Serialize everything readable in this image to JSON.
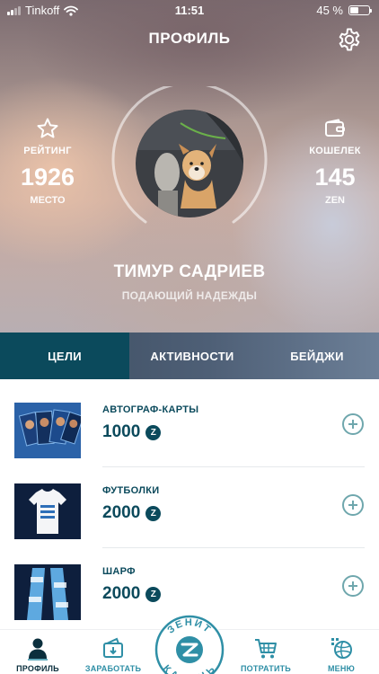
{
  "status_bar": {
    "carrier": "Tinkoff",
    "time": "11:51",
    "battery_percent": "45 %",
    "battery_level": 0.45
  },
  "header": {
    "title": "ПРОФИЛЬ",
    "settings_icon": "gear-icon"
  },
  "rating": {
    "label": "РЕЙТИНГ",
    "value": "1926",
    "sub": "МЕСТО",
    "icon": "star-icon"
  },
  "wallet": {
    "label": "КОШЕЛЕК",
    "value": "145",
    "sub": "ZEN",
    "icon": "wallet-icon"
  },
  "user": {
    "name": "ТИМУР САДРИЕВ",
    "status": "ПОДАЮЩИЙ НАДЕЖДЫ"
  },
  "tabs": [
    {
      "label": "ЦЕЛИ",
      "active": true
    },
    {
      "label": "АКТИВНОСТИ",
      "active": false
    },
    {
      "label": "БЕЙДЖИ",
      "active": false
    }
  ],
  "goals": [
    {
      "name": "АВТОГРАФ-КАРТЫ",
      "price": "1000",
      "coin_symbol": "Z"
    },
    {
      "name": "ФУТБОЛКИ",
      "price": "2000",
      "coin_symbol": "Z"
    },
    {
      "name": "ШАРФ",
      "price": "2000",
      "coin_symbol": "Z"
    }
  ],
  "tabbar": {
    "items": [
      {
        "label": "ПРОФИЛЬ",
        "icon": "profile-icon",
        "active": true
      },
      {
        "label": "ЗАРАБОТАТЬ",
        "icon": "wallet-earn-icon",
        "active": false
      },
      {
        "label": "ПОТРАТИТЬ",
        "icon": "cart-icon",
        "active": false
      },
      {
        "label": "МЕНЮ",
        "icon": "menu-ball-icon",
        "active": false
      }
    ],
    "center_logo": {
      "top_text": "ЗЕНИТ",
      "bottom_text": "КАЗАНЬ"
    }
  },
  "colors": {
    "primary": "#0b4a5c",
    "accent": "#2f8fa6",
    "plus": "#6fa7ad"
  }
}
